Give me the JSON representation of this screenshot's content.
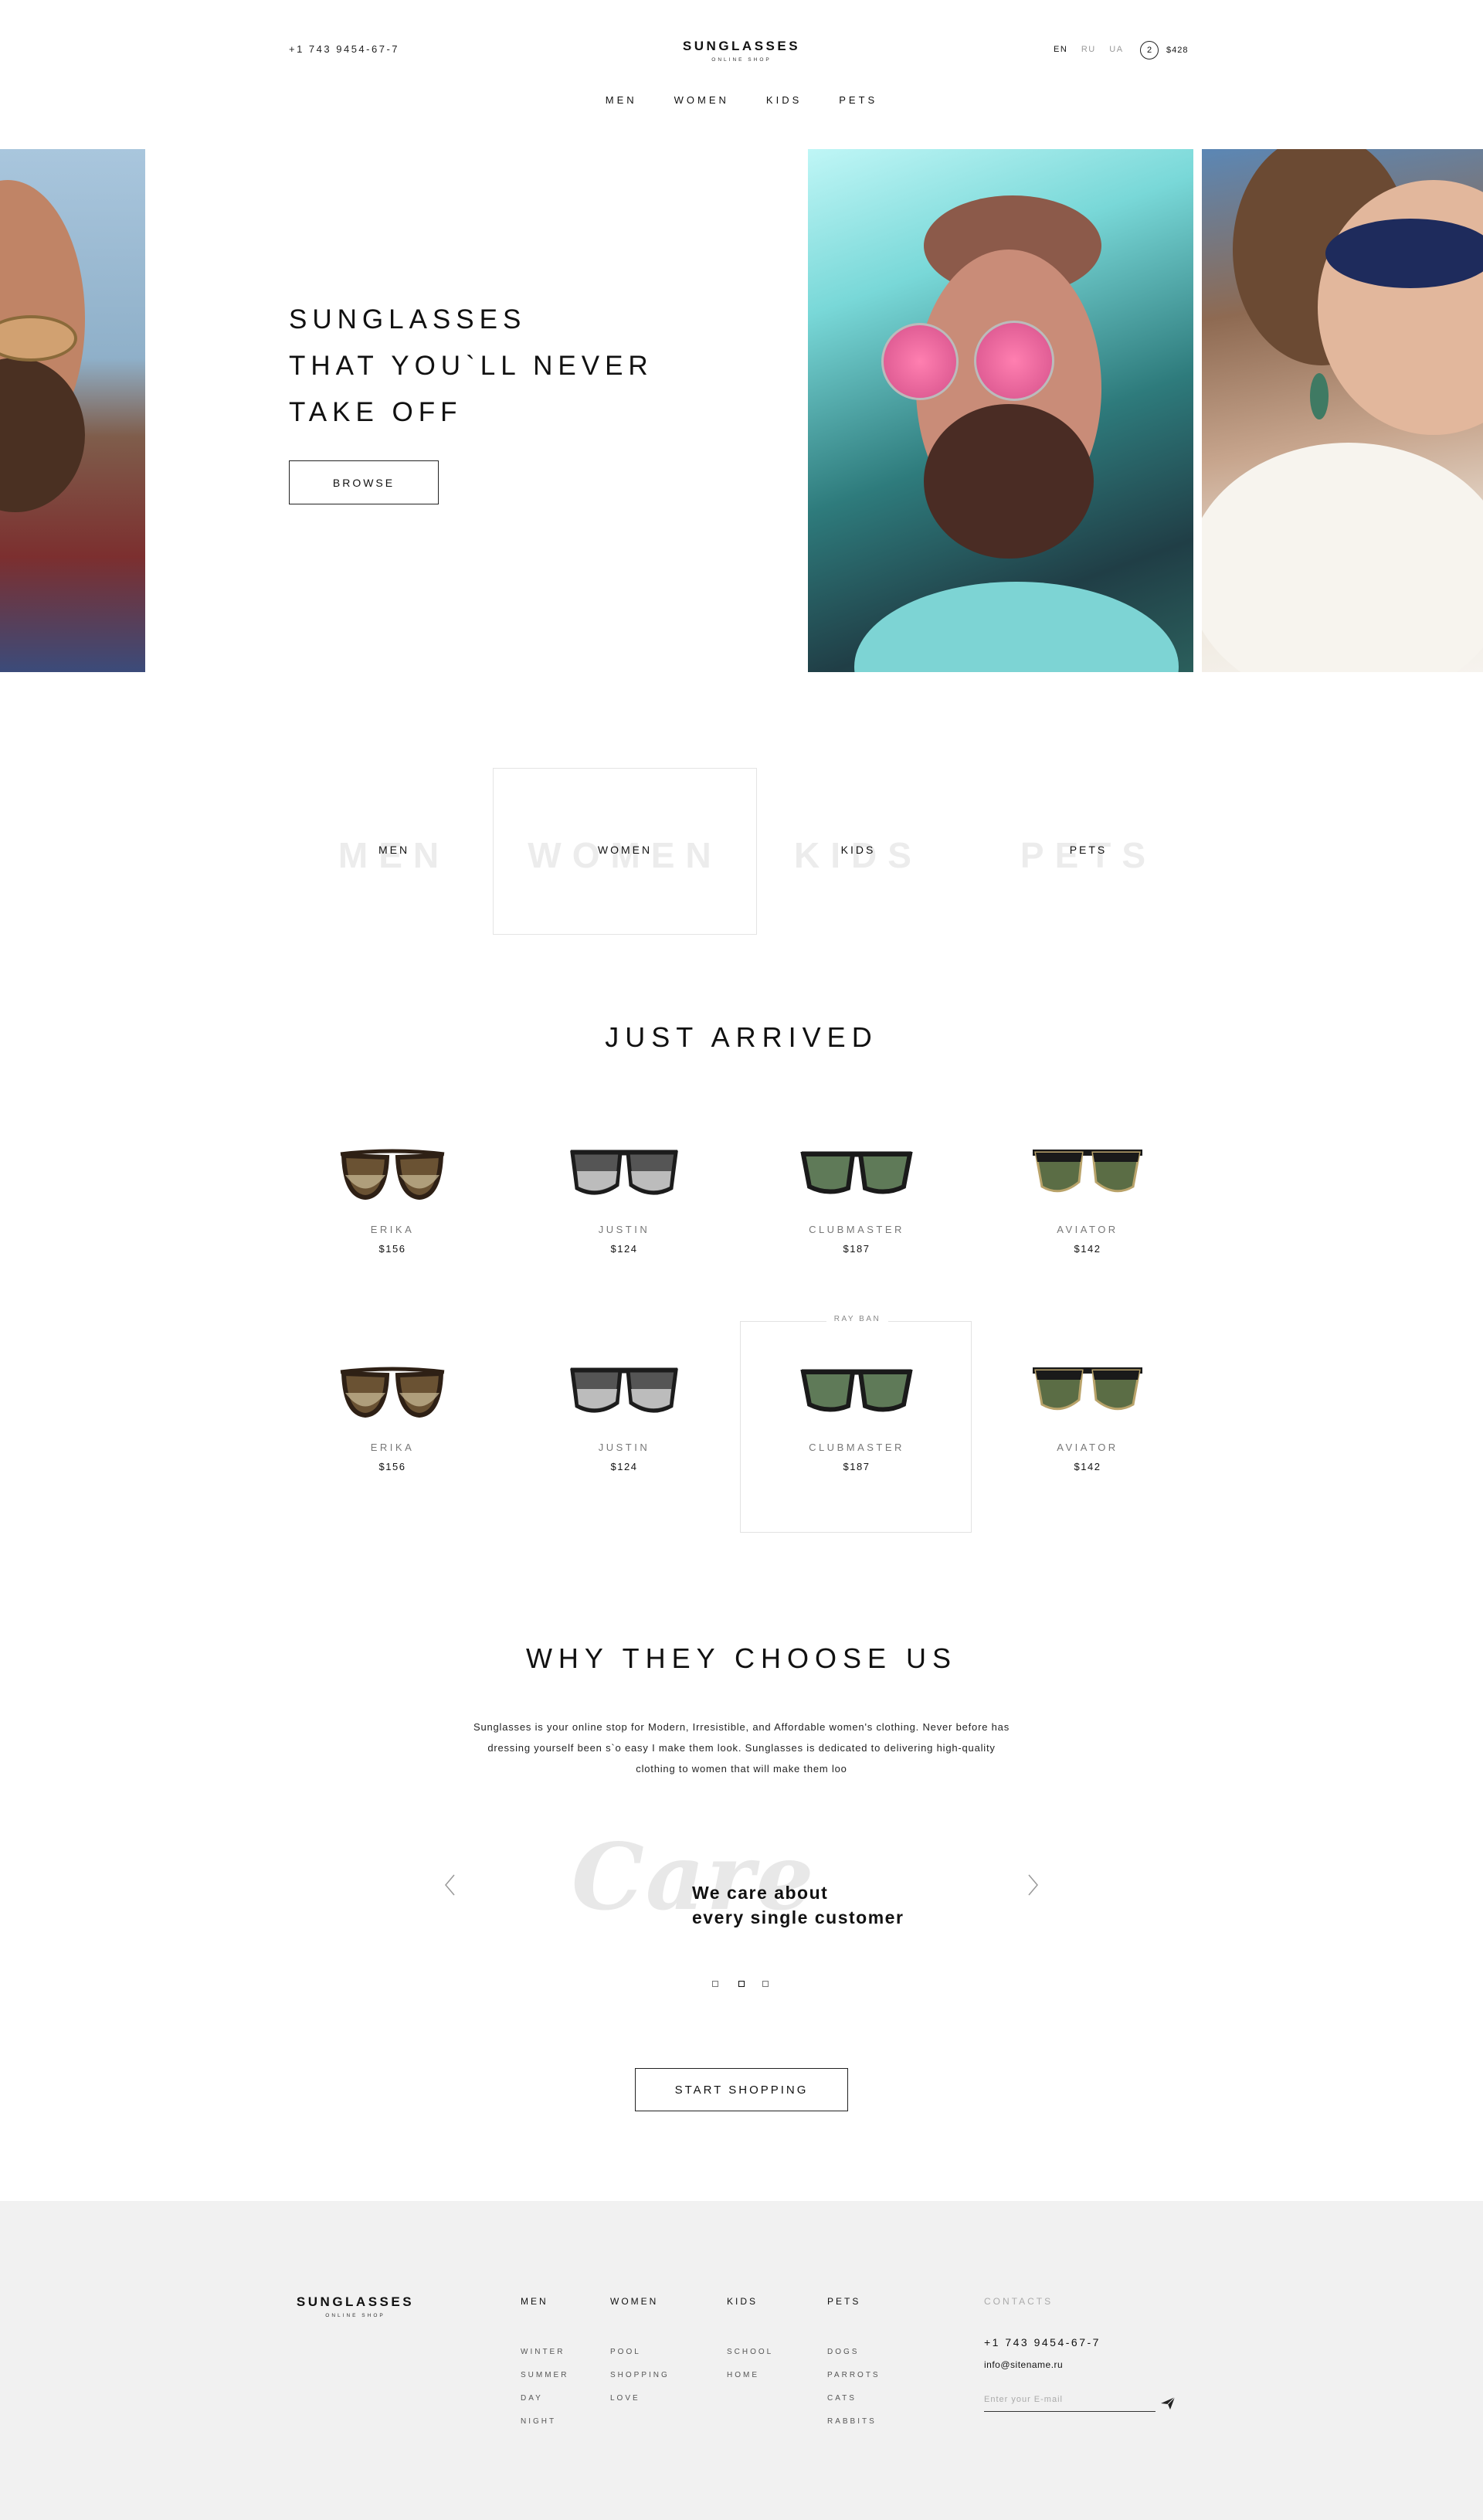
{
  "header": {
    "phone": "+1 743 9454-67-7",
    "logo_main": "SUNGLASSES",
    "logo_sub": "ONLINE SHOP",
    "languages": [
      "EN",
      "RU",
      "UA"
    ],
    "cart_count": "2",
    "cart_total": "$428",
    "nav": [
      "MEN",
      "WOMEN",
      "KIDS",
      "PETS"
    ]
  },
  "hero": {
    "headline": [
      "SUNGLASSES",
      "THAT YOU`LL NEVER",
      "TAKE OFF"
    ],
    "button": "BROWSE"
  },
  "categories": [
    {
      "label": "MEN",
      "watermark": "MEN"
    },
    {
      "label": "WOMEN",
      "watermark": "WOMEN"
    },
    {
      "label": "KIDS",
      "watermark": "KIDS"
    },
    {
      "label": "PETS",
      "watermark": "PETS"
    }
  ],
  "just_arrived": {
    "title": "JUST ARRIVED",
    "featured_brand": "RAY BAN",
    "products": [
      {
        "name": "ERIKA",
        "price": "$156"
      },
      {
        "name": "JUSTIN",
        "price": "$124"
      },
      {
        "name": "CLUBMASTER",
        "price": "$187"
      },
      {
        "name": "AVIATOR",
        "price": "$142"
      },
      {
        "name": "ERIKA",
        "price": "$156"
      },
      {
        "name": "JUSTIN",
        "price": "$124"
      },
      {
        "name": "CLUBMASTER",
        "price": "$187"
      },
      {
        "name": "AVIATOR",
        "price": "$142"
      }
    ]
  },
  "why": {
    "title": "WHY THEY CHOOSE US",
    "text": "Sunglasses is your online stop for Modern, Irresistible, and Affordable women's clothing. Never before has dressing yourself been s`o easy I make them look. Sunglasses  is dedicated to delivering high-quality clothing to women that will make them loo",
    "script_word": "Care",
    "slide_line1": "We care about",
    "slide_line2": "every single customer",
    "cta": "START SHOPPING"
  },
  "footer": {
    "logo_main": "SUNGLASSES",
    "logo_sub": "ONLINE SHOP",
    "columns": [
      {
        "title": "MEN",
        "items": [
          "WINTER",
          "SUMMER",
          "DAY",
          "NIGHT"
        ]
      },
      {
        "title": "WOMEN",
        "items": [
          "POOL",
          "SHOPPING",
          "LOVE"
        ]
      },
      {
        "title": "KIDS",
        "items": [
          "SCHOOL",
          "HOME"
        ]
      },
      {
        "title": "PETS",
        "items": [
          "DOGS",
          "PARROTS",
          "CATS",
          "RABBITS"
        ]
      }
    ],
    "contacts_title": "CONTACTS",
    "phone": "+1 743 9454-67-7",
    "email": "info@sitename.ru",
    "email_placeholder": "Enter your E-mail"
  }
}
